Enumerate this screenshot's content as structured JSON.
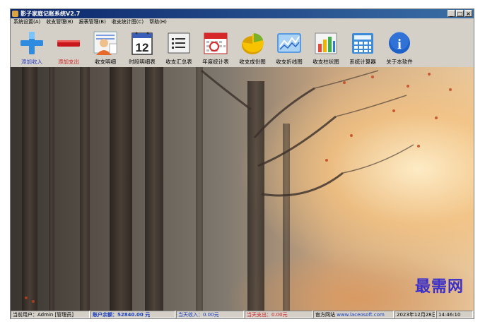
{
  "window": {
    "title": "影子家庭记账系统V2.7",
    "buttons": [
      "_",
      "□",
      "×"
    ]
  },
  "menu": [
    {
      "label": "系统设置(A)"
    },
    {
      "label": "收支管理(B)"
    },
    {
      "label": "报表管理(B)"
    },
    {
      "label": "收支统计图(C)"
    },
    {
      "label": "帮助(H)"
    }
  ],
  "toolbar": [
    {
      "label": "添加收入",
      "icon": "plus-icon"
    },
    {
      "label": "添加支出",
      "icon": "minus-icon"
    },
    {
      "label": "收支明细",
      "icon": "user-detail-icon"
    },
    {
      "label": "时段明细表",
      "icon": "calendar-icon",
      "calendar_number": "12"
    },
    {
      "label": "收支汇总表",
      "icon": "list-icon"
    },
    {
      "label": "年度统计表",
      "icon": "annual-calendar-icon"
    },
    {
      "label": "收支成份图",
      "icon": "pie-chart-icon"
    },
    {
      "label": "收支折线图",
      "icon": "line-chart-icon"
    },
    {
      "label": "收支柱状图",
      "icon": "bar-chart-icon"
    },
    {
      "label": "系统计算器",
      "icon": "calculator-icon"
    },
    {
      "label": "关于本软件",
      "icon": "info-icon",
      "glyph": "i"
    }
  ],
  "watermark": "最需网",
  "status": {
    "user": "当前用户：Admin [管理员]",
    "balance": "账户余额：52840.00 元",
    "today_income": "当天收入：0.00元",
    "today_expense": "当天支出：0.00元",
    "website_label": "官方网站",
    "website": "www.laceosoft.com",
    "date": "2023年12月28日",
    "time": "14:46:10"
  },
  "colors": {
    "titlebar": "#0a246a",
    "accent_blue": "#2a3fc4",
    "accent_red": "#d02020",
    "watermark": "#3b2fc9"
  }
}
